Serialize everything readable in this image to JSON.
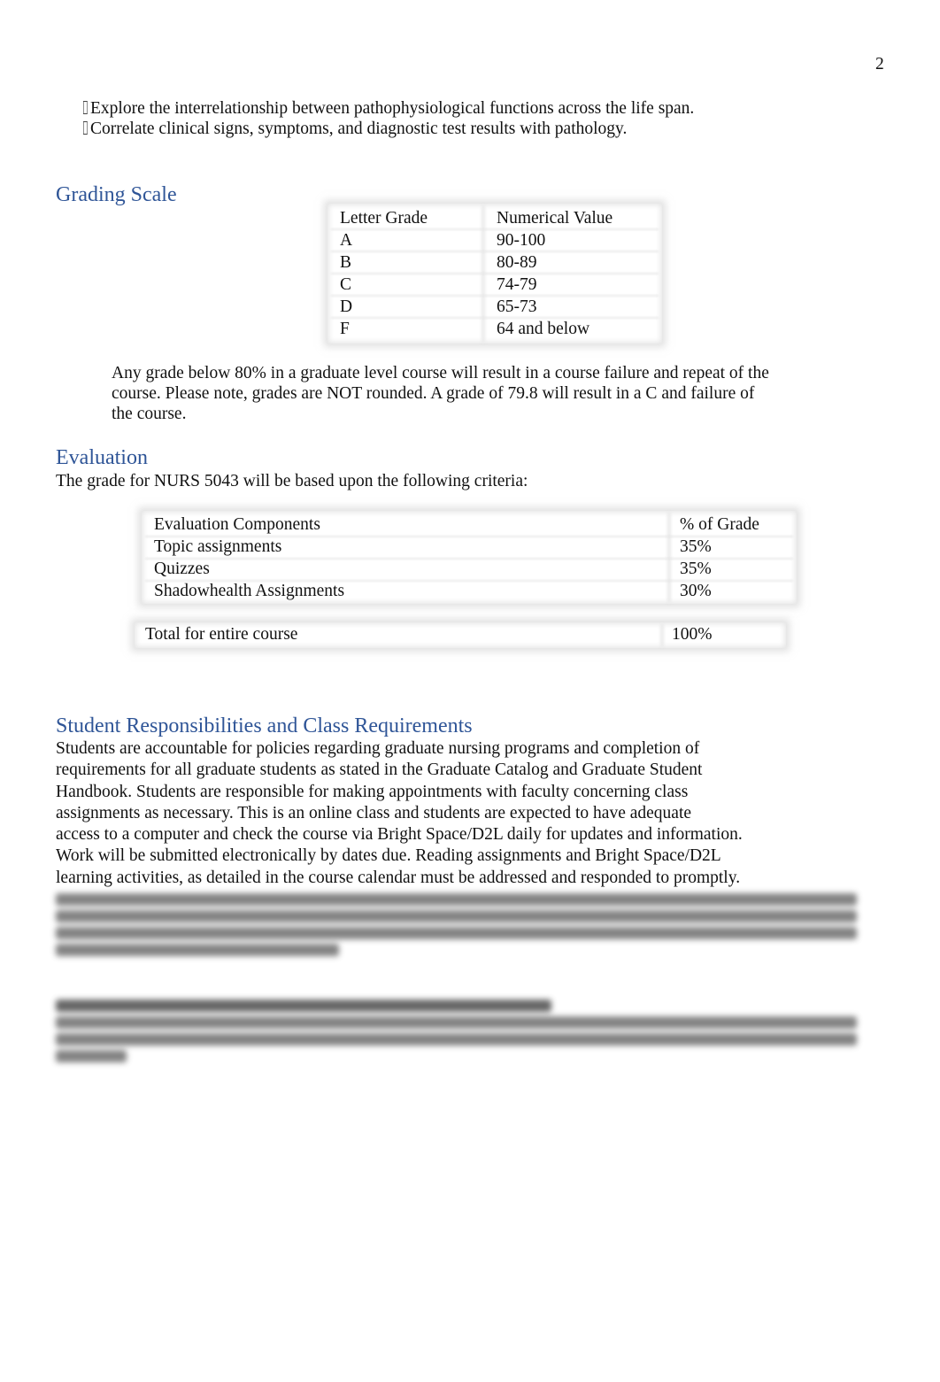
{
  "page": {
    "number": "2"
  },
  "objectives": [
    {
      "bullet_icon": "missing-glyph-icon",
      "text": "Explore the interrelationship between pathophysiological functions across the life span."
    },
    {
      "bullet_icon": "missing-glyph-icon",
      "text": "Correlate clinical signs, symptoms, and diagnostic test results with pathology."
    }
  ],
  "grading_scale": {
    "heading": "Grading Scale",
    "headers": [
      "Letter Grade",
      "Numerical Value"
    ],
    "rows": [
      [
        "A",
        "90-100"
      ],
      [
        "B",
        "80-89"
      ],
      [
        "C",
        "74-79"
      ],
      [
        "D",
        "65-73"
      ],
      [
        "F",
        "64 and below"
      ]
    ],
    "note_lines": [
      "Any grade below 80% in a graduate level course will result in a course failure and repeat of the",
      "course. Please note, grades are NOT rounded. A grade of 79.8 will result in a C and failure of",
      "the course."
    ]
  },
  "evaluation": {
    "heading": "Evaluation",
    "intro": "The grade for NURS 5043 will be based upon the following criteria:",
    "headers": [
      "Evaluation Components",
      "% of Grade"
    ],
    "rows": [
      [
        "Topic assignments",
        "35%"
      ],
      [
        "Quizzes",
        "35%"
      ],
      [
        "Shadowhealth Assignments",
        "30%"
      ]
    ],
    "total": [
      "Total for entire course",
      "100%"
    ]
  },
  "responsibilities": {
    "heading": "Student Responsibilities and Class Requirements",
    "lines": [
      "Students are accountable for policies regarding graduate nursing programs and completion of",
      "requirements for all graduate students as stated in the Graduate Catalog and Graduate Student",
      "Handbook. Students are responsible for making appointments with faculty concerning class",
      "assignments as necessary. This is an online class and students are expected to have adequate",
      "access to a computer and check the course via Bright Space/D2L daily for updates and information.",
      "Work will be submitted electronically by dates due. Reading assignments and Bright Space/D2L",
      "learning activities, as detailed in the course calendar must be addressed and responded to promptly."
    ]
  },
  "colors": {
    "heading": "#2f5597",
    "text": "#111111"
  }
}
